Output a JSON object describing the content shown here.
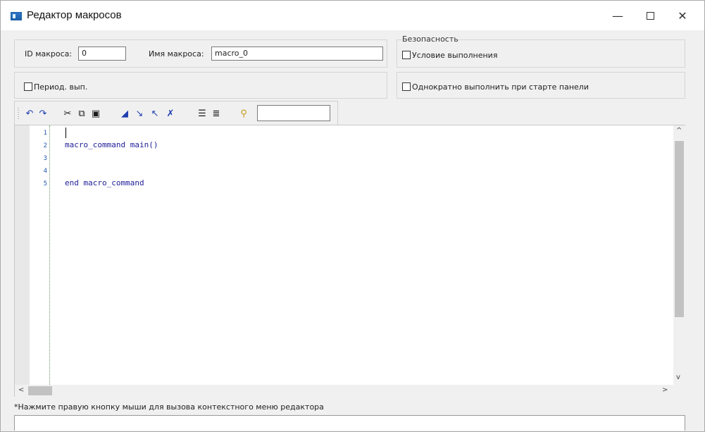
{
  "window": {
    "title": "Редактор макросов",
    "minimize": "—",
    "close": "✕"
  },
  "form": {
    "id_label": "ID макроса:",
    "id_value": "0",
    "name_label": "Имя макроса:",
    "name_value": "macro_0",
    "security_group": "Безопасность",
    "exec_condition": "Условие выполнения",
    "periodic_exec": "Период. вып.",
    "run_once": "Однократно выполнить при старте панели"
  },
  "toolbar": {
    "icons": [
      "undo-icon",
      "redo-icon",
      "cut-icon",
      "copy-icon",
      "paste-icon",
      "bookmark-toggle-icon",
      "bookmark-next-icon",
      "bookmark-prev-icon",
      "bookmark-clear-icon",
      "indent-icon",
      "outdent-icon",
      "find-icon"
    ],
    "find_value": ""
  },
  "editor": {
    "line_numbers": [
      "1",
      "2",
      "3",
      "4",
      "5"
    ],
    "lines": [
      "",
      "macro_command main()",
      "",
      "",
      "end macro_command"
    ]
  },
  "scroll": {
    "up": "^",
    "down": "v",
    "left": "<",
    "right": ">"
  },
  "status": {
    "hint": "*Нажмите правую кнопку мыши для вызова контекстного меню редактора"
  }
}
